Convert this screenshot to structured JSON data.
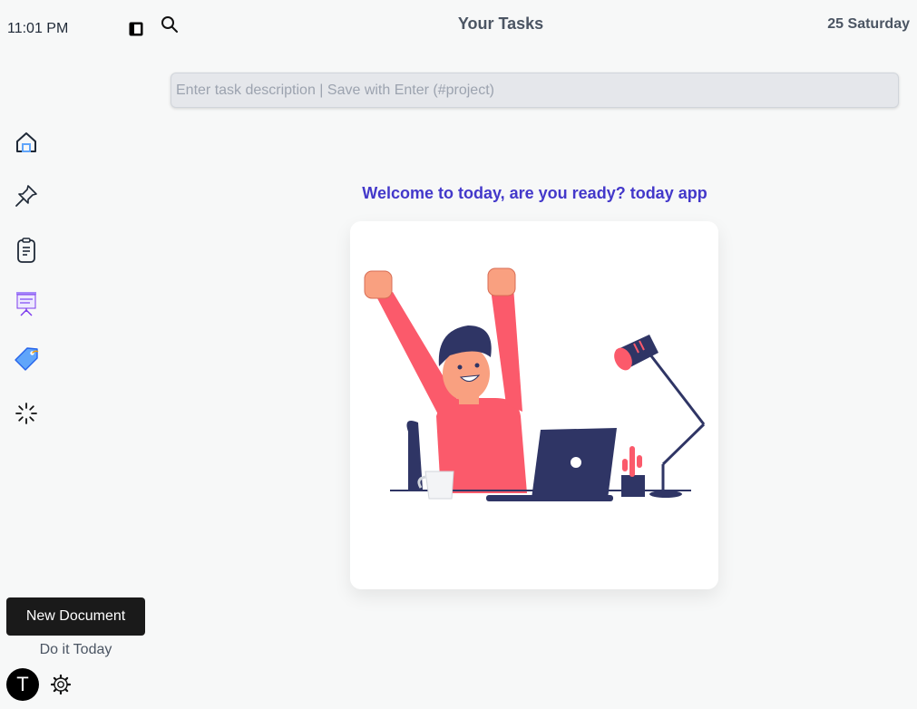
{
  "status": {
    "time": "11:01 PM",
    "date": "25 Saturday"
  },
  "header": {
    "title": "Your Tasks"
  },
  "task_input": {
    "placeholder": "Enter task description | Save with Enter (#project)",
    "value": ""
  },
  "sidebar": {
    "items": [
      {
        "icon": "home-icon"
      },
      {
        "icon": "pin-icon"
      },
      {
        "icon": "clipboard-icon"
      },
      {
        "icon": "presentation-board-icon"
      },
      {
        "icon": "tag-icon"
      },
      {
        "icon": "loading-spinner-icon"
      }
    ],
    "new_document_label": "New Document",
    "tagline": "Do it Today",
    "avatar_letter": "T"
  },
  "main": {
    "welcome_text": "Welcome to today, are you ready? today app"
  },
  "colors": {
    "accent": "#4338ca",
    "primary_button": "#1a1a1a",
    "background": "#f7f8f8"
  }
}
